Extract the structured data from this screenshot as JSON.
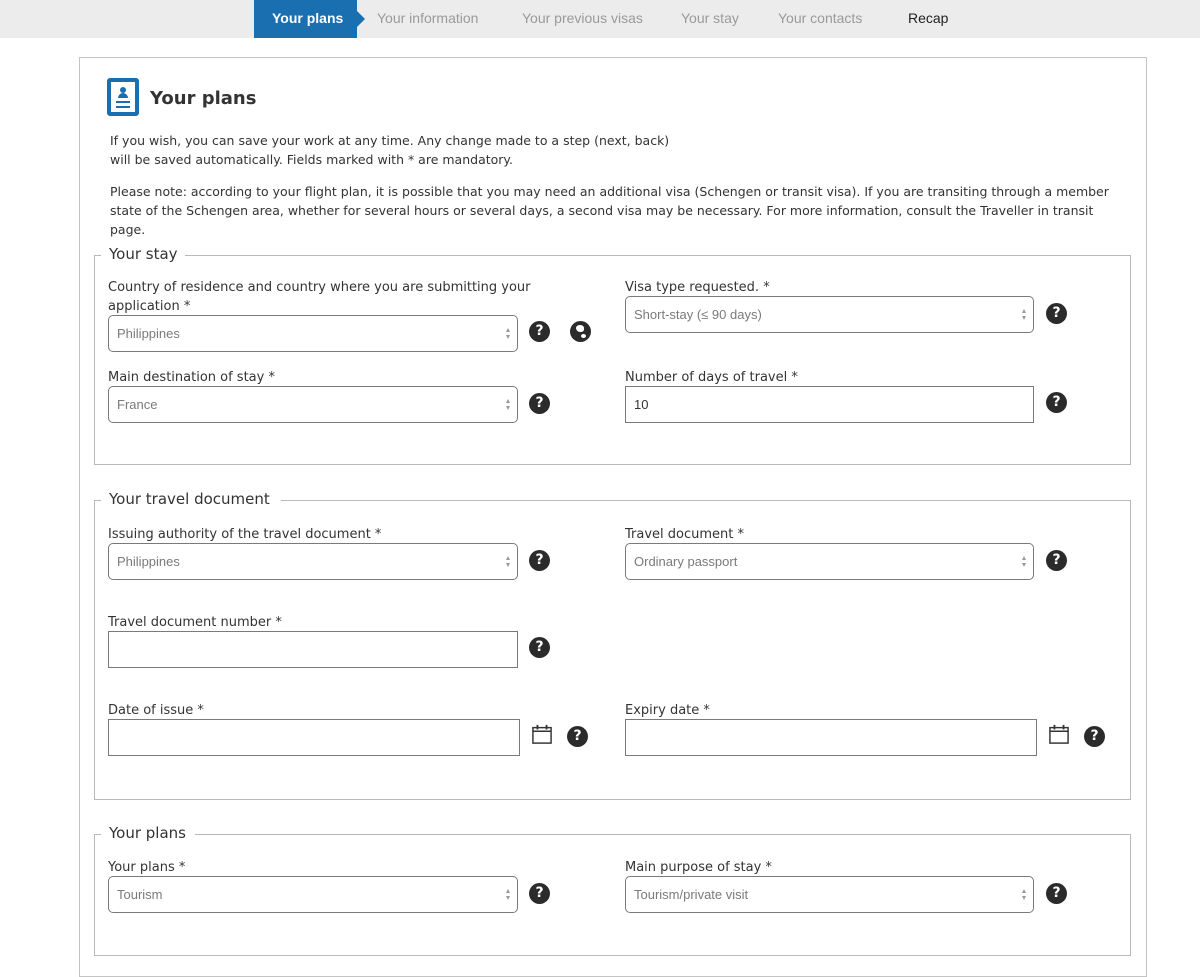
{
  "steps": [
    {
      "label": "Your plans",
      "state": "active"
    },
    {
      "label": "Your information",
      "state": "upcoming"
    },
    {
      "label": "Your previous visas",
      "state": "upcoming"
    },
    {
      "label": "Your stay",
      "state": "upcoming"
    },
    {
      "label": "Your contacts",
      "state": "upcoming"
    },
    {
      "label": "Recap",
      "state": "upcoming"
    }
  ],
  "colors": {
    "accent": "#1a6fb0",
    "help_icon": "#2b2b2b"
  },
  "page": {
    "title": "Your plans",
    "icon": "id-card-icon",
    "intro1": "If you wish, you can save your work at any time. Any change made to a step (next, back) will be saved automatically. Fields marked with * are mandatory.",
    "intro2": "Please note: according to your flight plan, it is possible that you may need an additional visa (Schengen or transit visa). If you are transiting through a member state of the Schengen area, whether for several hours or several days, a second visa may be necessary. For more information, consult the Traveller in transit page."
  },
  "sections": {
    "stay": {
      "legend": "Your stay",
      "country_residence": {
        "label": "Country of residence and country where you are submitting your application *",
        "value": "Philippines"
      },
      "visa_type": {
        "label": "Visa type requested. *",
        "value": "Short-stay (≤ 90 days)"
      },
      "main_destination": {
        "label": "Main destination of stay *",
        "value": "France"
      },
      "days_travel": {
        "label": "Number of days of travel *",
        "value": "10"
      }
    },
    "document": {
      "legend": "Your travel document",
      "issuing_authority": {
        "label": "Issuing authority of the travel document *",
        "value": "Philippines"
      },
      "travel_document": {
        "label": "Travel document *",
        "value": "Ordinary passport"
      },
      "doc_number": {
        "label": "Travel document number *",
        "value": ""
      },
      "date_issue": {
        "label": "Date of issue *",
        "value": ""
      },
      "expiry_date": {
        "label": "Expiry date *",
        "value": ""
      }
    },
    "plans": {
      "legend": "Your plans",
      "your_plans": {
        "label": "Your plans *",
        "value": "Tourism"
      },
      "main_purpose": {
        "label": "Main purpose of stay *",
        "value": "Tourism/private visit"
      }
    }
  },
  "icons": {
    "help": "?",
    "globe": "globe-icon",
    "calendar": "calendar-icon"
  }
}
